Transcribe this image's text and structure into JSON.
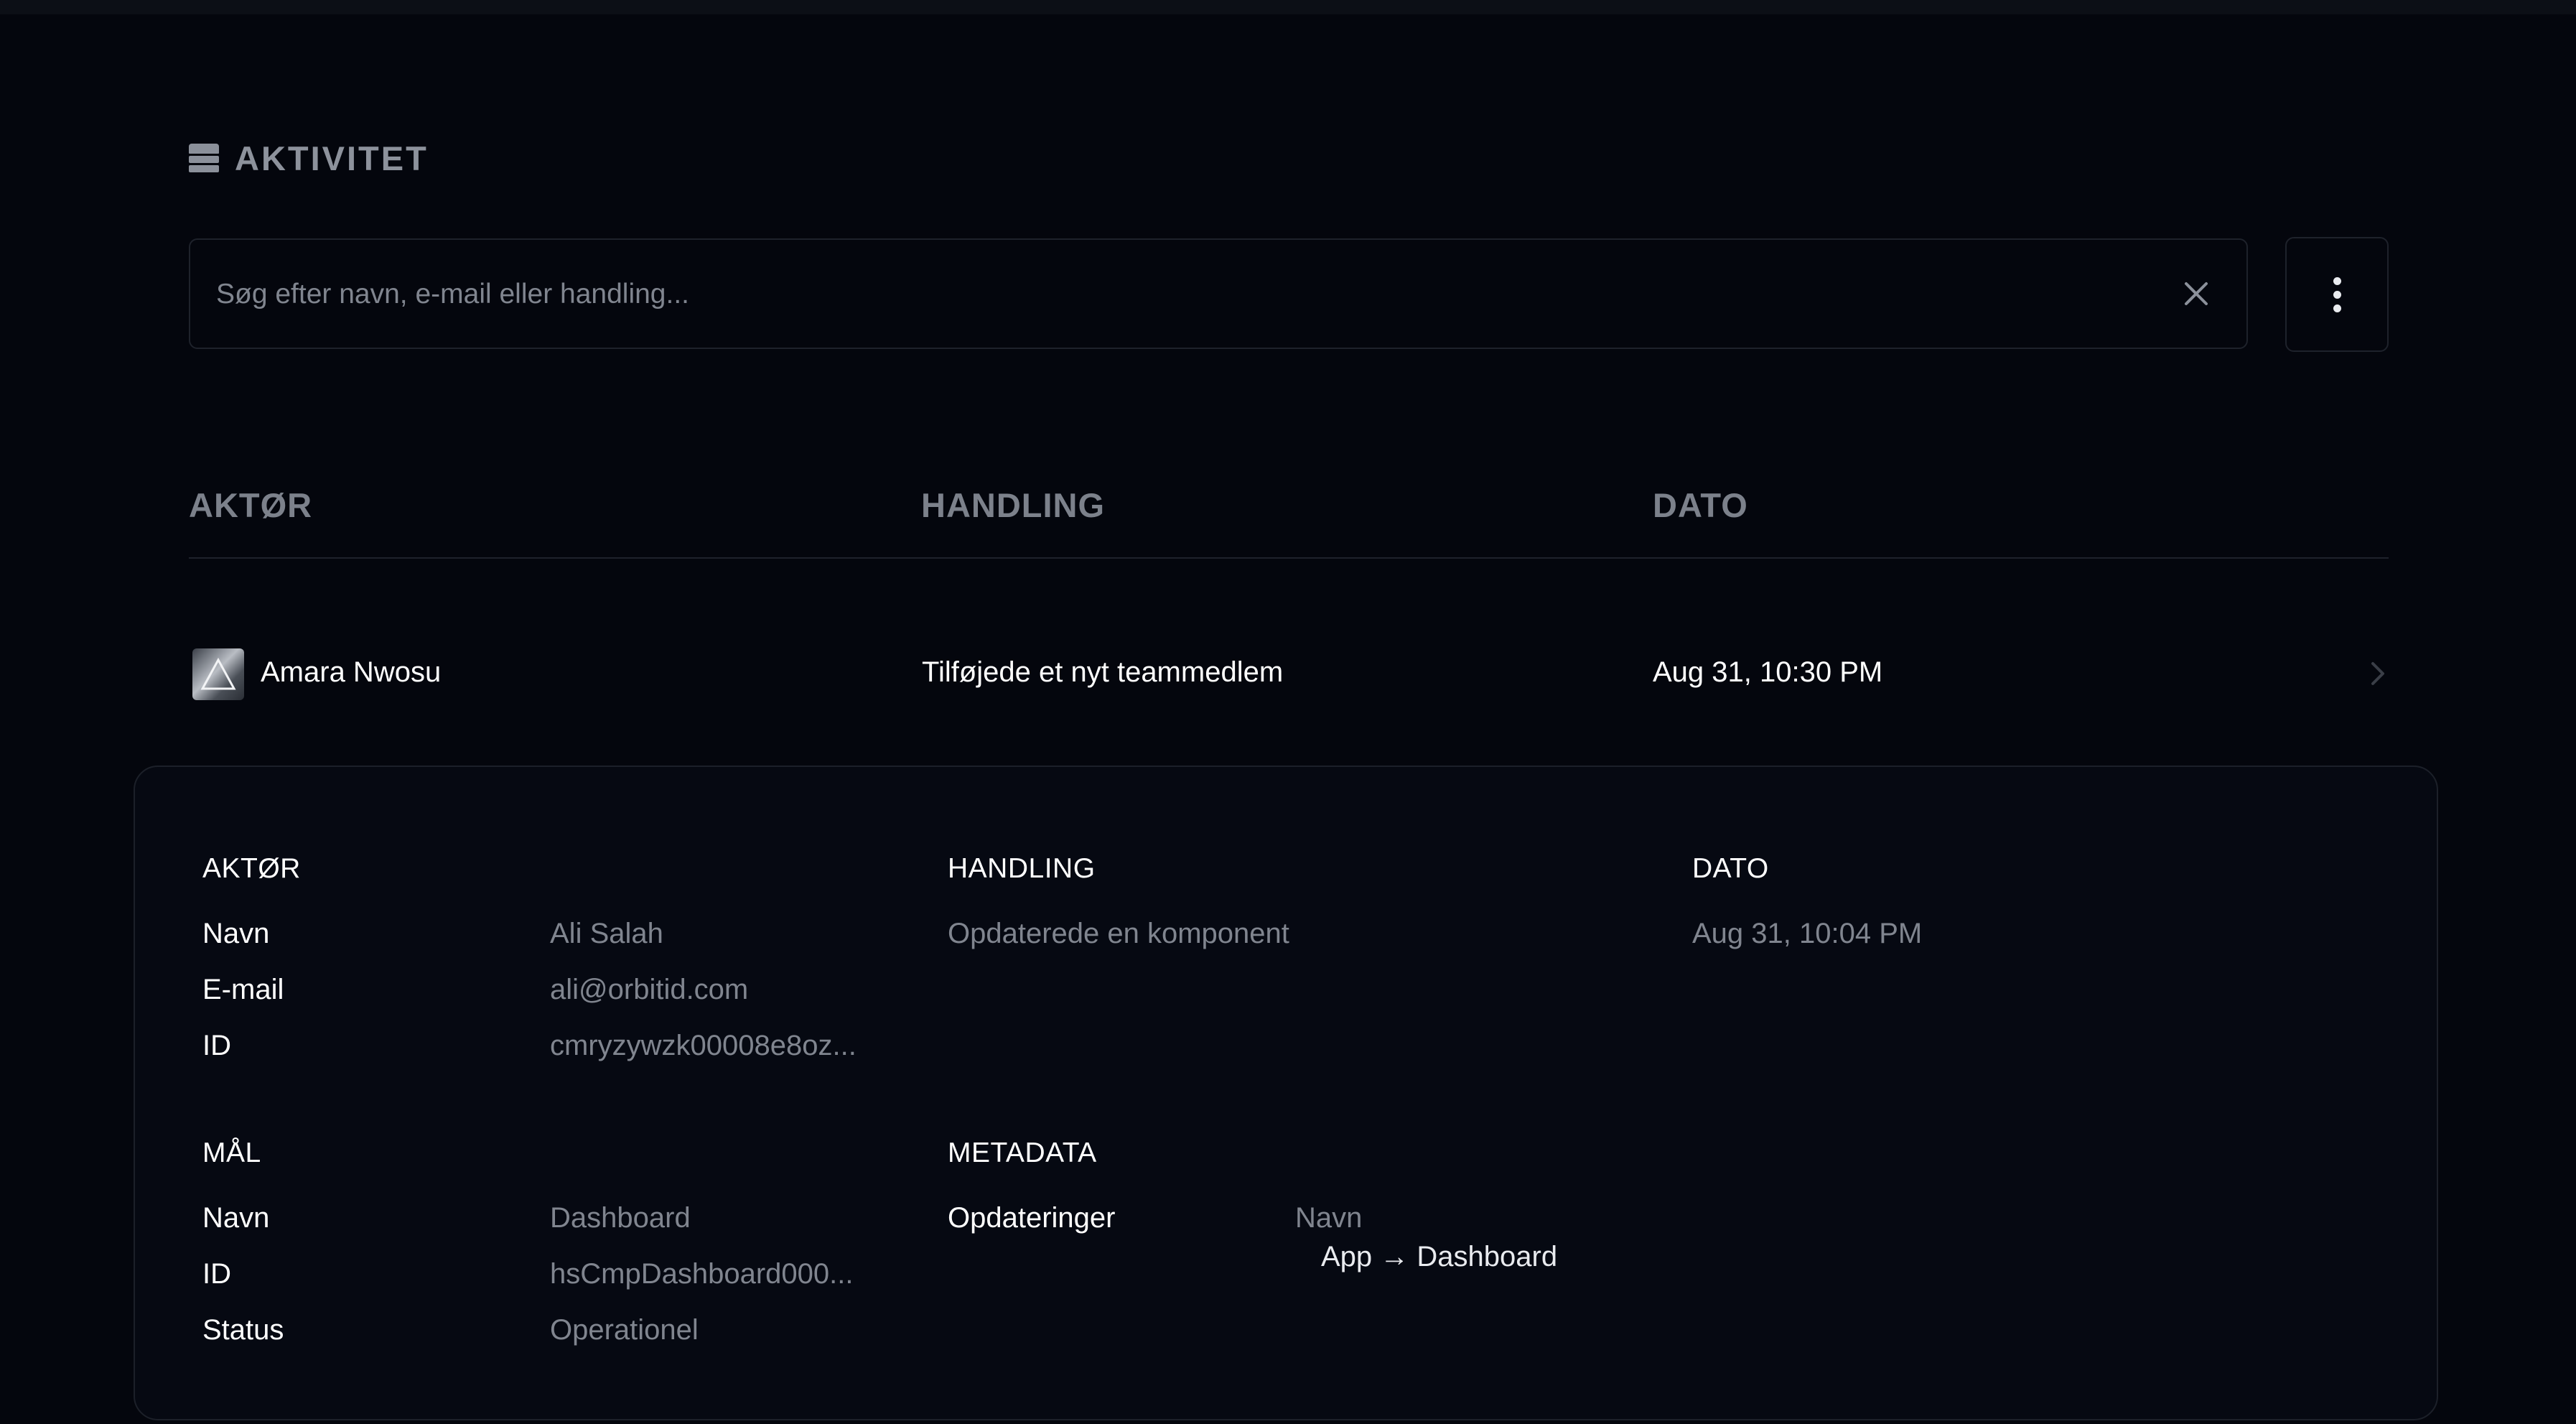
{
  "header": {
    "title": "AKTIVITET",
    "icon": "database-icon"
  },
  "search": {
    "placeholder": "Søg efter navn, e-mail eller handling...",
    "value": ""
  },
  "table": {
    "columns": [
      "AKTØR",
      "HANDLING",
      "DATO"
    ],
    "rows": [
      {
        "actor": "Amara Nwosu",
        "action": "Tilføjede et nyt teammedlem",
        "date": "Aug 31, 10:30 PM"
      }
    ]
  },
  "details": {
    "actor": {
      "title": "AKTØR",
      "name_label": "Navn",
      "name": "Ali Salah",
      "email_label": "E-mail",
      "email": "ali@orbitid.com",
      "id_label": "ID",
      "id": "cmryzywzk00008e8oz..."
    },
    "action": {
      "title": "HANDLING",
      "value": "Opdaterede en komponent"
    },
    "date": {
      "title": "DATO",
      "value": "Aug 31, 10:04 PM"
    },
    "target": {
      "title": "MÅL",
      "name_label": "Navn",
      "name": "Dashboard",
      "id_label": "ID",
      "id": "hsCmpDashboard000...",
      "status_label": "Status",
      "status": "Operationel"
    },
    "metadata": {
      "title": "METADATA",
      "updates_label": "Opdateringer",
      "field": "Navn",
      "change": "App → Dashboard"
    }
  },
  "colors": {
    "background": "#04060d",
    "panel": "#060912",
    "border": "#1e222b",
    "muted_text": "#80858f",
    "text": "#ffffff"
  }
}
